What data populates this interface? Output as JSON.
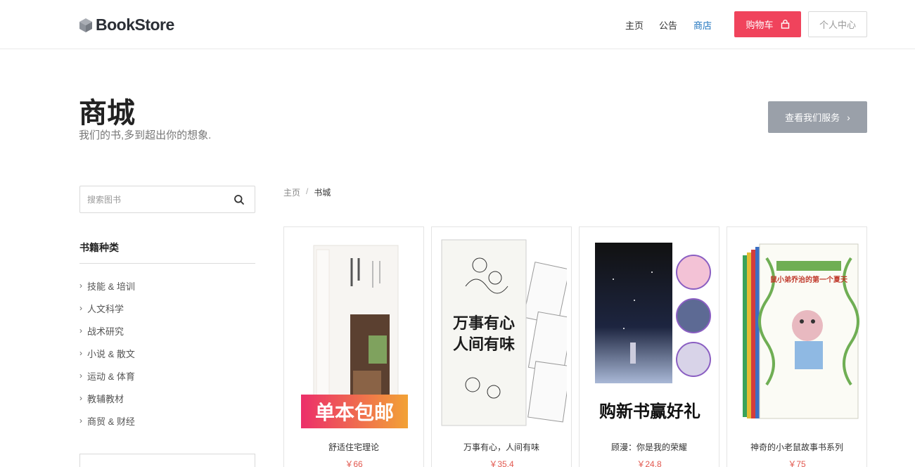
{
  "header": {
    "logo_text": "BookStore",
    "nav": [
      "主页",
      "公告",
      "商店"
    ],
    "active_nav_index": 2,
    "cart_label": "购物车",
    "user_label": "个人中心"
  },
  "page": {
    "title": "商城",
    "subtitle": "我们的书,多到超出你的想象.",
    "service_button": "查看我们服务"
  },
  "sidebar": {
    "search_placeholder": "搜索图书",
    "category_title": "书籍种类",
    "categories": [
      "技能 & 培训",
      "人文科学",
      "战术研究",
      "小说 & 散文",
      "运动 & 体育",
      "教辅教材",
      "商贸 & 财经"
    ]
  },
  "breadcrumb": {
    "home": "主页",
    "separator": "/",
    "current": "书城"
  },
  "products": [
    {
      "title": "舒适住宅理论",
      "price": "￥66",
      "cover_banner": "单本包邮"
    },
    {
      "title": "万事有心，人间有味",
      "price": "￥35.4",
      "cover_text": "万事有心人间有味"
    },
    {
      "title": "顾漫：你是我的荣耀",
      "price": "￥24.8",
      "cover_banner": "购新书赢好礼"
    },
    {
      "title": "神奇的小老鼠故事书系列",
      "price": "￥75",
      "cover_text": "鼠小弟乔治的第一个夏天"
    }
  ],
  "colors": {
    "accent_red": "#f0435c",
    "nav_active": "#1e73be",
    "price": "#e2584f",
    "service_button": "#9aa0a9"
  }
}
